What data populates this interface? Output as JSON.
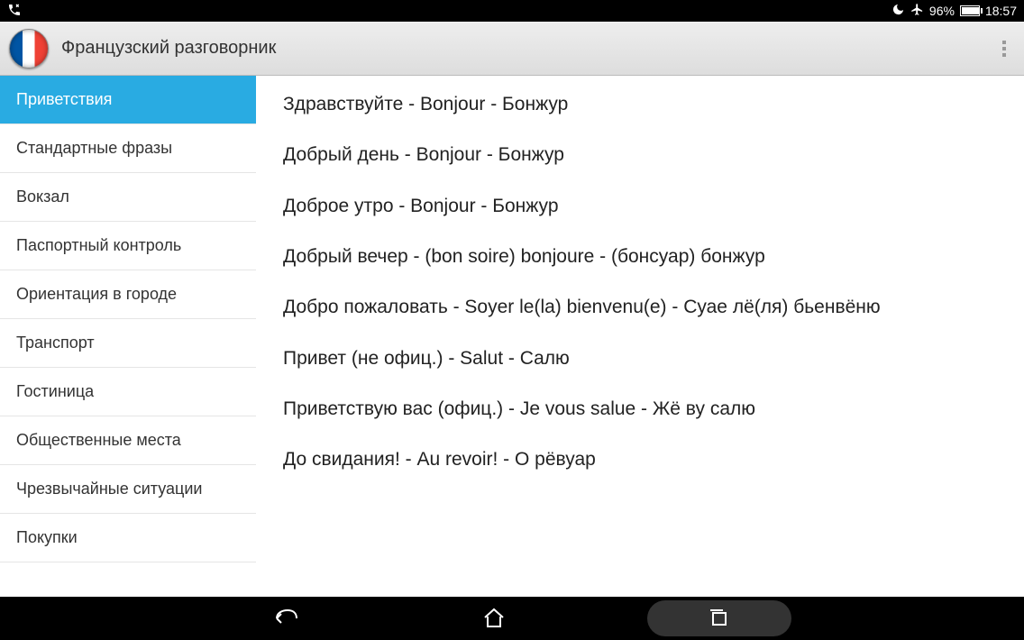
{
  "status": {
    "battery_percent": "96%",
    "time": "18:57"
  },
  "header": {
    "title": "Французский разговорник"
  },
  "sidebar": {
    "items": [
      {
        "label": "Приветствия",
        "active": true
      },
      {
        "label": "Стандартные фразы",
        "active": false
      },
      {
        "label": "Вокзал",
        "active": false
      },
      {
        "label": "Паспортный контроль",
        "active": false
      },
      {
        "label": "Ориентация в городе",
        "active": false
      },
      {
        "label": "Транспорт",
        "active": false
      },
      {
        "label": "Гостиница",
        "active": false
      },
      {
        "label": "Общественные места",
        "active": false
      },
      {
        "label": "Чрезвычайные ситуации",
        "active": false
      },
      {
        "label": "Покупки",
        "active": false
      }
    ]
  },
  "phrases": [
    "Здравствуйте - Bonjour - Бонжур",
    "Добрый день - Bonjour - Бонжур",
    "Доброе утро - Bonjour - Бонжур",
    "Добрый вечер - (bon soire) bonjoure - (бонсуар) бонжур",
    "Добро пожаловать - Soyer le(la) bienvenu(e) - Суае лё(ля) бьенвёню",
    "Привет (не офиц.) - Salut - Салю",
    "Приветствую вас (офиц.) - Je vous salue - Жё ву салю",
    "До свидания! - Au revoir! - О рёвуар"
  ]
}
